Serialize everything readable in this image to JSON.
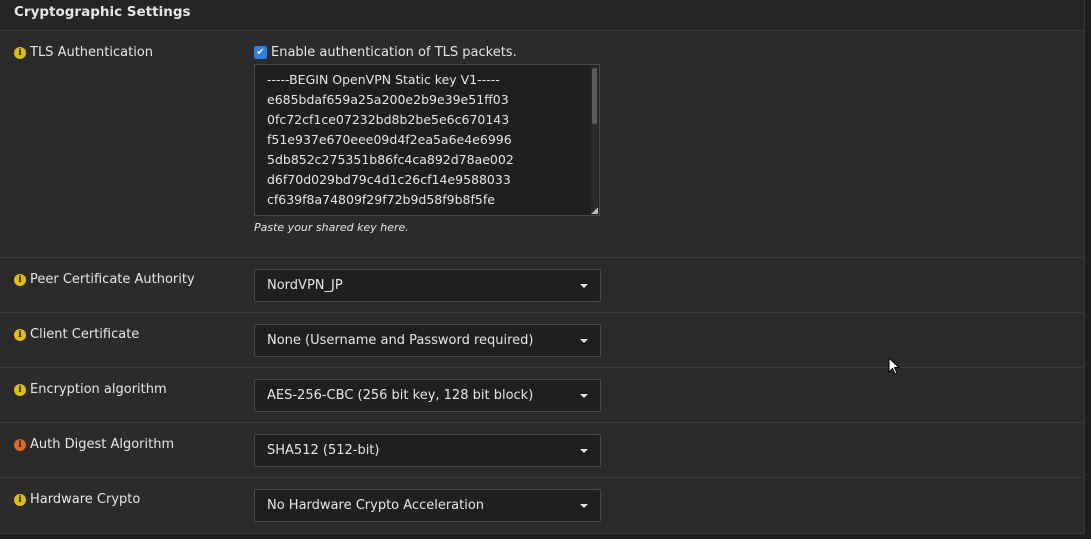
{
  "section": {
    "title": "Cryptographic Settings"
  },
  "tls": {
    "label": "TLS Authentication",
    "checkbox_label": "Enable authentication of TLS packets.",
    "checked": true,
    "key_lines": [
      "-----BEGIN OpenVPN Static key V1-----",
      "e685bdaf659a25a200e2b9e39e51ff03",
      "0fc72cf1ce07232bd8b2be5e6c670143",
      "f51e937e670eee09d4f2ea5a6e4e6996",
      "5db852c275351b86fc4ca892d78ae002",
      "d6f70d029bd79c4d1c26cf14e9588033",
      "cf639f8a74809f29f72b9d58f9b8f5fe"
    ],
    "help": "Paste your shared key here."
  },
  "peer_ca": {
    "label": "Peer Certificate Authority",
    "value": "NordVPN_JP"
  },
  "client_cert": {
    "label": "Client Certificate",
    "value": "None (Username and Password required)"
  },
  "encryption": {
    "label": "Encryption algorithm",
    "value": "AES-256-CBC (256 bit key, 128 bit block)"
  },
  "auth_digest": {
    "label": "Auth Digest Algorithm",
    "value": "SHA512 (512-bit)"
  },
  "hw_crypto": {
    "label": "Hardware Crypto",
    "value": "No Hardware Crypto Acceleration"
  },
  "colors": {
    "info_icon": "#e0c000",
    "info_icon_alert": "#e06a1a",
    "checkbox": "#2f7de1"
  }
}
